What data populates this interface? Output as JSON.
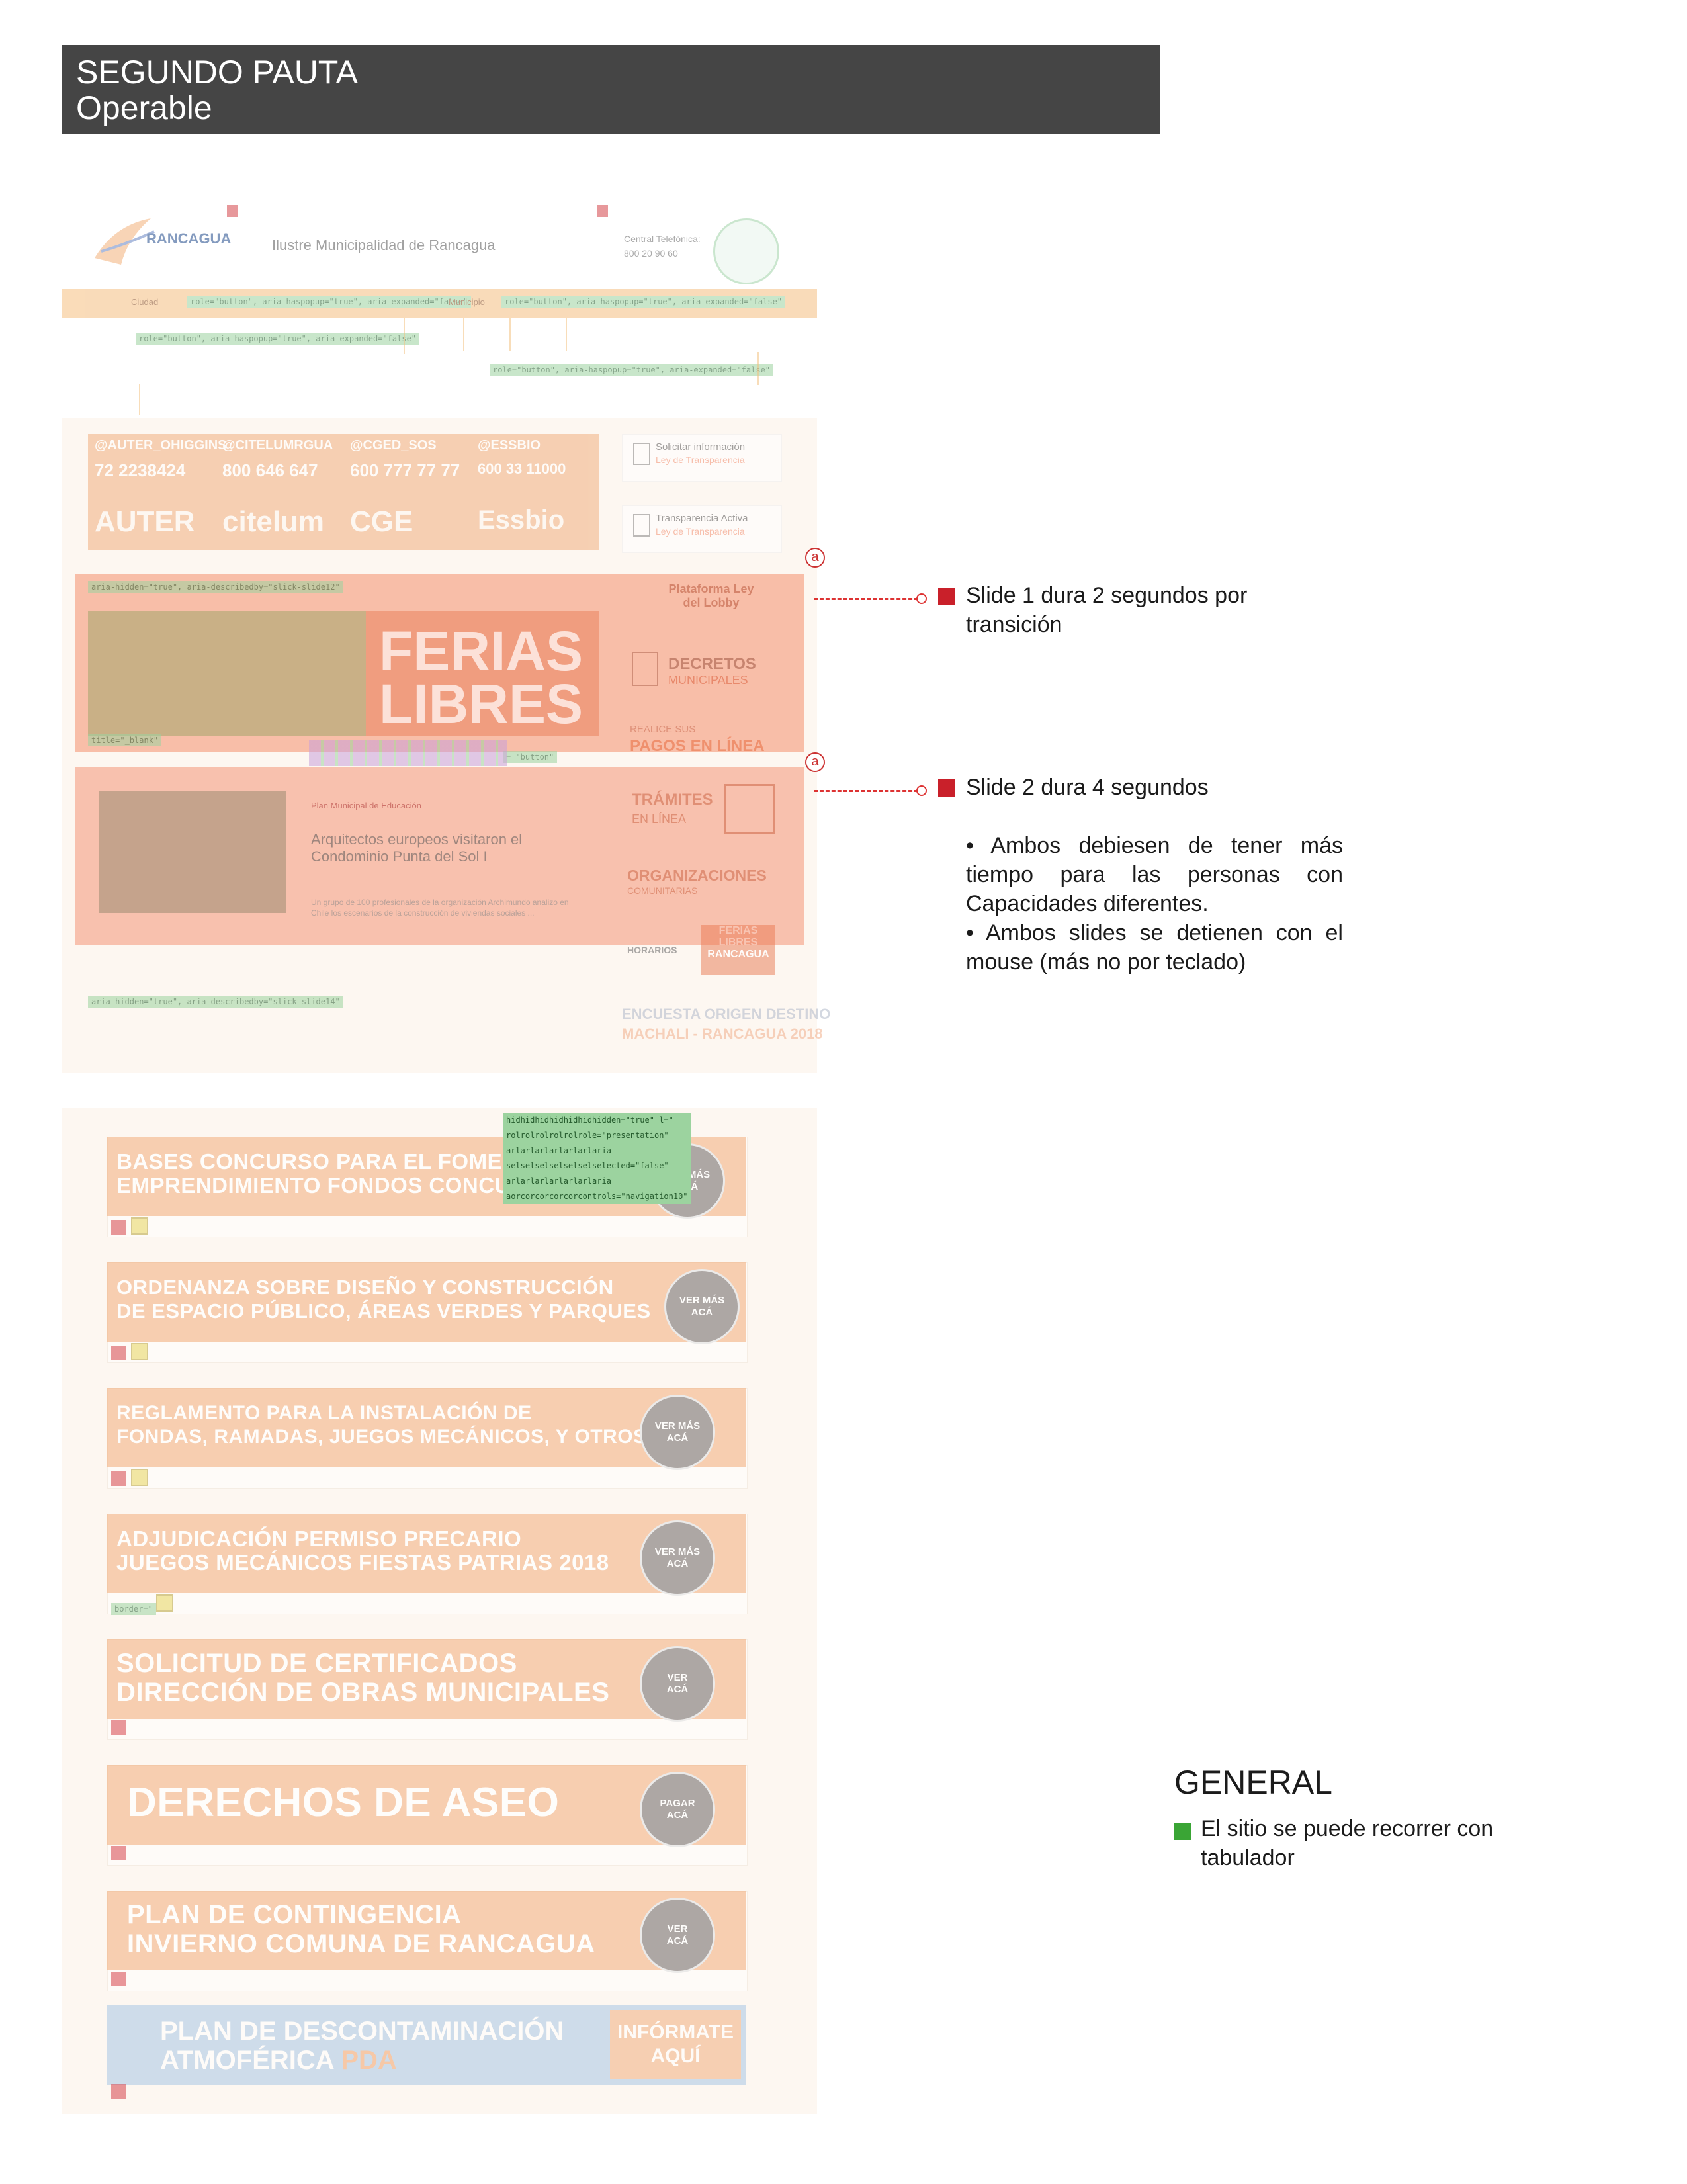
{
  "header": {
    "title": "SEGUNDO PAUTA",
    "subtitle": "Operable"
  },
  "site": {
    "logo_text": "RANCAGUA",
    "site_name": "Ilustre Municipalidad de Rancagua",
    "phone_label": "Central Telefónica:",
    "phone_number": "800 20 90 60",
    "nav_left": "Ciudad",
    "nav_mid": "Municipio",
    "tag_button_1": "role=\"button\", aria-haspopup=\"true\", aria-expanded=\"false\"",
    "tag_button_2": "role=\"button\", aria-haspopup=\"true\", aria-expanded=\"false\"",
    "tag_button_3": "role=\"button\", aria-haspopup=\"true\", aria-expanded=\"false\"",
    "tag_button_4": "role=\"button\", aria-haspopup=\"true\", aria-expanded=\"false\""
  },
  "social": [
    {
      "handle": "@AUTER_OHIGGINS",
      "phone": "72 2238424",
      "brand": "AUTER"
    },
    {
      "handle": "@CITELUMRGUA",
      "phone": "800 646 647",
      "brand": "citelum"
    },
    {
      "handle": "@CGED_SOS",
      "phone": "600 777 77 77",
      "brand": "CGE"
    },
    {
      "handle": "@ESSBIO",
      "phone": "600 33 11000",
      "brand": "Essbio"
    }
  ],
  "sidebar": {
    "info_title": "Solicitar información",
    "info_sub": "Ley de Transparencia",
    "transp_title": "Transparencia Activa",
    "transp_sub": "Ley de Transparencia",
    "lobby": "Plataforma Ley del Lobby",
    "decretos_title": "DECRETOS",
    "decretos_sub": "MUNICIPALES",
    "pagos_pre": "REALICE SUS",
    "pagos": "PAGOS EN LÍNEA",
    "tramites": "TRÁMITES",
    "tramites_sub": "EN LÍNEA",
    "org": "ORGANIZACIONES",
    "org_sub": "COMUNITARIAS",
    "horarios": "HORARIOS",
    "ferias_small": "FERIAS LIBRES RANCAGUA",
    "encuesta": "ENCUESTA ORIGEN DESTINO",
    "encuesta_sub": "MACHALI - RANCAGUA 2018"
  },
  "slides": {
    "banner_text": "FERIAS LIBRES",
    "tag_slide_1": "aria-hidden=\"true\", aria-describedby=\"slick-slide12\"",
    "tag_slide_2": "aria-hidden=\"true\", aria-describedby=\"slick-slide14\"",
    "tag_button": "= \"button\"",
    "tag_blank": "title=\"_blank\"",
    "news_category": "Plan Municipal de Educación",
    "news_title": "Arquitectos europeos visitaron el Condominio Punta del Sol I",
    "news_body": "Un grupo de 100 profesionales de la organización Archimundo analizo en Chile los escenarios de la construcción de viviendas sociales ..."
  },
  "annotations": {
    "marker": "a",
    "slide1_note": "Slide 1 dura 2 segundos por transición",
    "slide2_note": "Slide 2 dura 4 segundos",
    "bullet1": "• Ambos debiesen de tener más tiempo para las personas con Capacidades diferentes.",
    "bullet2": "• Ambos slides se detienen con el mouse (más no por teclado)"
  },
  "panel3_tags": {
    "t1": "hidhidhidhidhidhidhidden=\"true\" l=\"",
    "t2": "rolrolrolrolrolrole=\"presentation\"",
    "t3": "arlarlarlarlarlarlaria",
    "t4": "selselselselselselselected=\"false\"",
    "t5": "arlarlarlarlarlarlaria",
    "t6": "aorcorcorcorcorcontrols=\"navigation10\"",
    "border": "border=\""
  },
  "cards": [
    {
      "text_1": "BASES CONCURSO PARA EL FOMENTO A",
      "text_2": "EMPRENDIMIENTO FONDOS CONCURSABLES",
      "btn_1": "VER MÁS",
      "btn_2": "ACÁ"
    },
    {
      "text_1": "ORDENANZA SOBRE DISEÑO Y CONSTRUCCIÓN",
      "text_2": "DE ESPACIO PÚBLICO, ÁREAS VERDES Y PARQUES",
      "btn_1": "VER MÁS",
      "btn_2": "ACÁ"
    },
    {
      "text_1": "REGLAMENTO PARA LA INSTALACIÓN DE",
      "text_2": "FONDAS, RAMADAS, JUEGOS MECÁNICOS, Y OTROS",
      "btn_1": "VER MÁS",
      "btn_2": "ACÁ"
    },
    {
      "text_1": "ADJUDICACIÓN PERMISO PRECARIO",
      "text_2": "JUEGOS MECÁNICOS FIESTAS PATRIAS 2018",
      "btn_1": "VER MÁS",
      "btn_2": "ACÁ"
    },
    {
      "text_1": "SOLICITUD DE CERTIFICADOS",
      "text_2": "DIRECCIÓN DE OBRAS MUNICIPALES",
      "btn_1": "VER",
      "btn_2": "ACÁ"
    },
    {
      "text_1": "DERECHOS DE ASEO",
      "text_2": "",
      "btn_1": "PAGAR",
      "btn_2": "ACÁ"
    },
    {
      "text_1": "PLAN DE CONTINGENCIA",
      "text_2": "INVIERNO COMUNA DE RANCAGUA",
      "btn_1": "VER",
      "btn_2": "ACÁ"
    }
  ],
  "pda": {
    "line1": "PLAN DE DESCONTAMINACIÓN",
    "line2": "ATMOFÉRICA",
    "line2_accent": "PDA",
    "btn_1": "INFÓRMATE",
    "btn_2": "AQUÍ"
  },
  "general": {
    "heading": "GENERAL",
    "note": "El sitio se puede recorrer con tabulador"
  },
  "colors": {
    "title_bar": "#454545",
    "overlay": "#f17850",
    "red_marker": "#c9202a",
    "green_marker": "#3aa535"
  }
}
